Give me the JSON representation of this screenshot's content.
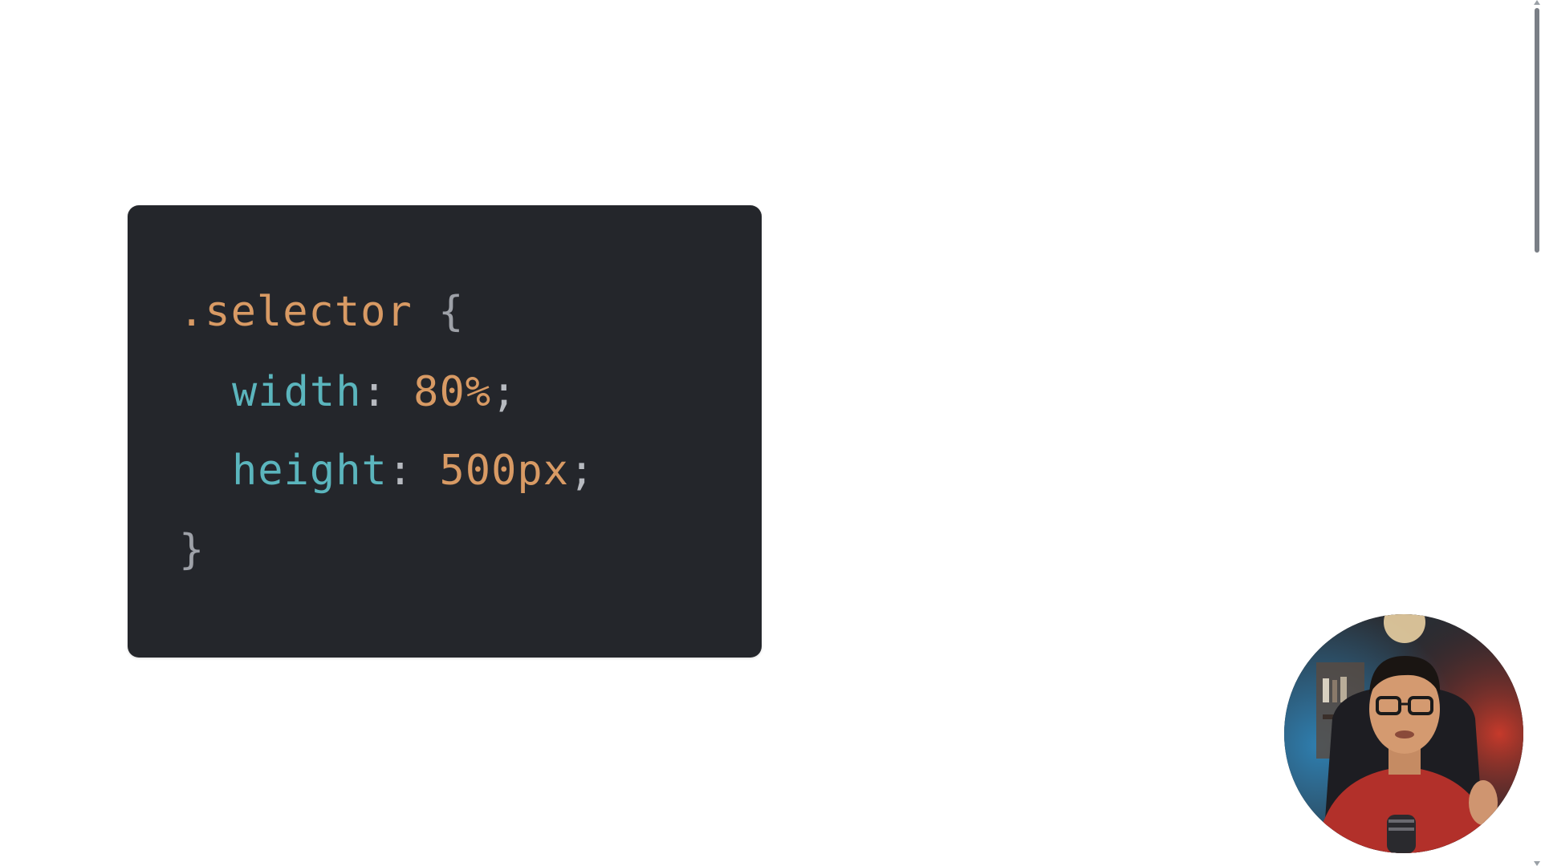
{
  "code": {
    "lines": [
      {
        "selector": ".selector",
        "open": "{"
      },
      {
        "property": "width",
        "colon": ":",
        "value": "80%",
        "semi": ";"
      },
      {
        "property": "height",
        "colon": ":",
        "value": "500px",
        "semi": ";"
      },
      {
        "close": "}"
      }
    ]
  },
  "colors": {
    "background": "#ffffff",
    "code_bg": "#24262b",
    "selector": "#d89a64",
    "property": "#5bb5bd",
    "value": "#d89a64",
    "punctuation": "#b7bac0"
  },
  "webcam": {
    "icon": "presenter-webcam-icon"
  }
}
